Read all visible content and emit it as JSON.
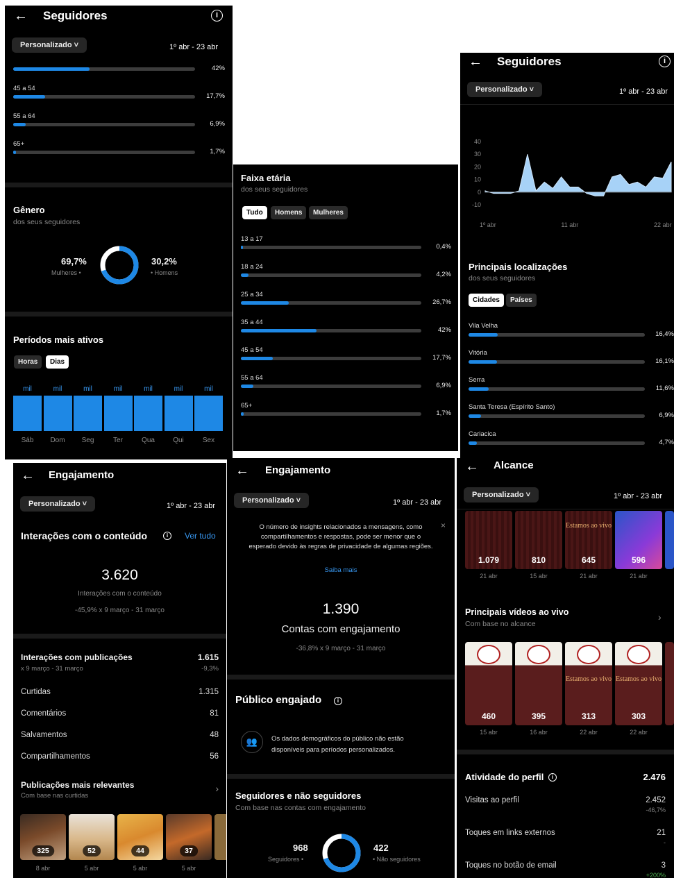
{
  "common": {
    "back": "←",
    "dropdown": "Personalizado ˅",
    "date_range": "1º abr - 23 abr",
    "info": "i"
  },
  "p1": {
    "title": "Seguidores",
    "age": [
      {
        "label": "",
        "pct": "42%",
        "v": 0.42
      },
      {
        "label": "45 a 54",
        "pct": "17,7%",
        "v": 0.177
      },
      {
        "label": "55 a 64",
        "pct": "6,9%",
        "v": 0.069
      },
      {
        "label": "65+",
        "pct": "1,7%",
        "v": 0.017
      }
    ],
    "gender_title": "Gênero",
    "gender_sub": "dos seus seguidores",
    "women_pct": "69,7%",
    "women_label": "Mulheres •",
    "men_pct": "30,2%",
    "men_label": "• Homens",
    "women_share": 0.697,
    "active_title": "Períodos mais ativos",
    "chip_hours": "Horas",
    "chip_days": "Dias",
    "bar_top": "mil",
    "days": [
      "Sáb",
      "Dom",
      "Seg",
      "Ter",
      "Qua",
      "Qui",
      "Sex"
    ]
  },
  "p2": {
    "title": "Faixa etária",
    "sub": "dos seus seguidores",
    "chips": [
      "Tudo",
      "Homens",
      "Mulheres"
    ],
    "rows": [
      {
        "label": "13 a 17",
        "pct": "0,4%",
        "v": 0.004
      },
      {
        "label": "18 a 24",
        "pct": "4,2%",
        "v": 0.042
      },
      {
        "label": "25 a 34",
        "pct": "26,7%",
        "v": 0.267
      },
      {
        "label": "35 a 44",
        "pct": "42%",
        "v": 0.42
      },
      {
        "label": "45 a 54",
        "pct": "17,7%",
        "v": 0.177
      },
      {
        "label": "55 a 64",
        "pct": "6,9%",
        "v": 0.069
      },
      {
        "label": "65+",
        "pct": "1,7%",
        "v": 0.017
      }
    ]
  },
  "p3": {
    "title": "Seguidores",
    "chart_data": {
      "type": "area",
      "x": [
        1,
        2,
        3,
        4,
        5,
        6,
        7,
        8,
        9,
        10,
        11,
        12,
        13,
        14,
        15,
        16,
        17,
        18,
        19,
        20,
        21,
        22,
        23
      ],
      "values": [
        1,
        -1,
        -1,
        -1,
        1,
        30,
        1,
        8,
        3,
        12,
        4,
        4,
        -1,
        -3,
        -3,
        12,
        14,
        6,
        8,
        4,
        12,
        11,
        24
      ],
      "yticks": [
        "40",
        "30",
        "20",
        "10",
        "0",
        "-10"
      ],
      "ylim": [
        -10,
        40
      ],
      "xticks": [
        "1º abr",
        "11 abr",
        "22 abr"
      ]
    },
    "loc_title": "Principais localizações",
    "loc_sub": "dos seus seguidores",
    "chip_cities": "Cidades",
    "chip_countries": "Países",
    "cities": [
      {
        "label": "Vila Velha",
        "pct": "16,4%",
        "v": 0.164
      },
      {
        "label": "Vitória",
        "pct": "16,1%",
        "v": 0.161
      },
      {
        "label": "Serra",
        "pct": "11,6%",
        "v": 0.116
      },
      {
        "label": "Santa Teresa (Espírito Santo)",
        "pct": "6,9%",
        "v": 0.069
      },
      {
        "label": "Cariacica",
        "pct": "4,7%",
        "v": 0.047
      }
    ]
  },
  "p4": {
    "title": "Engajamento",
    "interactions_title": "Interações com o conteúdo",
    "see_all": "Ver tudo",
    "total": "3.620",
    "total_label": "Interações com o conteúdo",
    "total_change": "-45,9% x 9 março - 31 março",
    "posts_title": "Interações com publicações",
    "posts_sub": "x 9 março - 31 março",
    "posts_val": "1.615",
    "posts_change": "-9,3%",
    "rows": [
      {
        "label": "Curtidas",
        "value": "1.315"
      },
      {
        "label": "Comentários",
        "value": "81"
      },
      {
        "label": "Salvamentos",
        "value": "48"
      },
      {
        "label": "Compartilhamentos",
        "value": "56"
      }
    ],
    "top_title": "Publicações mais relevantes",
    "top_sub": "Com base nas curtidas",
    "thumbs": [
      {
        "num": "325",
        "date": "8 abr"
      },
      {
        "num": "52",
        "date": "5 abr"
      },
      {
        "num": "44",
        "date": "5 abr"
      },
      {
        "num": "37",
        "date": "5 abr"
      }
    ]
  },
  "p5": {
    "title": "Engajamento",
    "notice": "O número de insights relacionados a mensagens, como compartilhamentos e respostas, pode ser menor que o esperado devido às regras de privacidade de algumas regiões.",
    "learn_more": "Saiba mais",
    "close": "×",
    "accounts": "1.390",
    "accounts_label": "Contas com engajamento",
    "accounts_change": "-36,8% x 9 março - 31 março",
    "audience_title": "Público engajado",
    "audience_msg": "Os dados demográficos do público não estão disponíveis para períodos personalizados.",
    "split_title": "Seguidores e não seguidores",
    "split_sub": "Com base nas contas com engajamento",
    "followers": "968",
    "followers_label": "Seguidores •",
    "nonfollowers": "422",
    "nonfollowers_label": "• Não seguidores",
    "followers_share": 0.696
  },
  "p6": {
    "title": "Alcance",
    "top_reels": [
      {
        "num": "1.079",
        "date": "21 abr"
      },
      {
        "num": "810",
        "date": "15 abr"
      },
      {
        "num": "645",
        "date": "21 abr"
      },
      {
        "num": "596",
        "date": "21 abr"
      }
    ],
    "live_title": "Principais vídeos ao vivo",
    "live_sub": "Com base no alcance",
    "live": [
      {
        "num": "460",
        "date": "15 abr"
      },
      {
        "num": "395",
        "date": "16 abr"
      },
      {
        "num": "313",
        "date": "22 abr"
      },
      {
        "num": "303",
        "date": "22 abr"
      }
    ],
    "overlay_text": "Estamos ao vivo",
    "profile_title": "Atividade do perfil",
    "profile_total": "2.476",
    "profile_rows": [
      {
        "label": "Visitas ao perfil",
        "value": "2.452",
        "change": "-46,7%"
      },
      {
        "label": "Toques em links externos",
        "value": "21",
        "change": "-"
      },
      {
        "label": "Toques no botão de email",
        "value": "3",
        "change": "+200%"
      }
    ]
  }
}
